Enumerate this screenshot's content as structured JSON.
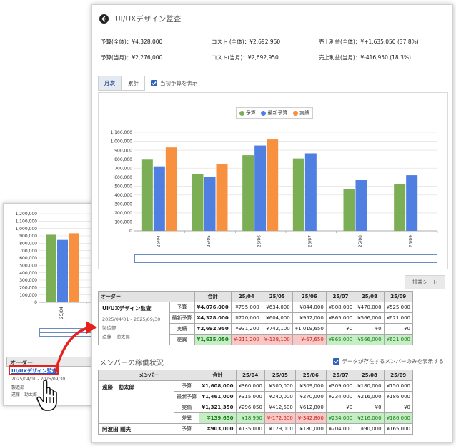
{
  "header": {
    "title": "UI/UXデザイン監査"
  },
  "summary": {
    "budget_total": "予算(全体)：¥4,328,000",
    "budget_current": "予算(当月)：¥2,276,000",
    "cost_total": "コスト (全体)：¥2,692,950",
    "cost_current": "コスト(当月)：¥2,692,950",
    "profit_total": "売上利益(全体)：¥+1,635,050 (37.8%)",
    "profit_current": "売上利益(当月)：¥-416,950 (18.3%)"
  },
  "tabs": {
    "monthly": "月次",
    "cumulative": "累計",
    "show_initial_budget": "当初予算を表示"
  },
  "pl_sheet_button": "損益シート",
  "colors": {
    "budget": "#7bae55",
    "latest_budget": "#4f7fe0",
    "actual": "#f7913f",
    "negative_bg": "#f9c8c6",
    "positive_bg": "#c5eec5"
  },
  "chart_data": [
    {
      "type": "bar",
      "categories": [
        "25/04",
        "25/05",
        "25/06",
        "25/07",
        "25/08",
        "25/09"
      ],
      "series": [
        {
          "name": "予算",
          "values": [
            795000,
            634000,
            844000,
            808000,
            470000,
            525000
          ]
        },
        {
          "name": "最新予算",
          "values": [
            720000,
            604000,
            952000,
            865000,
            566000,
            621000
          ]
        },
        {
          "name": "実績",
          "values": [
            931200,
            742100,
            1019650,
            0,
            0,
            0
          ]
        }
      ],
      "y_ticks": [
        "0",
        "100,000",
        "200,000",
        "300,000",
        "400,000",
        "500,000",
        "600,000",
        "700,000",
        "800,000",
        "900,000",
        "1,000,000",
        "1,100,000"
      ],
      "ylim": [
        0,
        1100000
      ],
      "legend": "top-center"
    },
    {
      "type": "bar",
      "categories": [
        "25/04"
      ],
      "series": [
        {
          "name": "予算",
          "values": [
            915000
          ]
        },
        {
          "name": "最新予算",
          "values": [
            845000
          ]
        },
        {
          "name": "実績",
          "values": [
            935000
          ]
        }
      ],
      "y_ticks": [
        "0",
        "100,000",
        "200,000",
        "300,000",
        "400,000",
        "500,000",
        "600,000",
        "700,000",
        "800,000",
        "900,000",
        "1,000,000",
        "1,100,000",
        "1,200,000"
      ],
      "ylim": [
        0,
        1200000
      ]
    }
  ],
  "order_table": {
    "headers": [
      "オーダー",
      "合計",
      "25/04",
      "25/05",
      "25/06",
      "25/07",
      "25/08",
      "25/09"
    ],
    "order_name": "UI/UXデザイン監査",
    "period": "2025/04/01 - 2025/09/30",
    "department": "製造部",
    "manager": "遠藤　勘太郎",
    "rows": [
      {
        "label": "予算",
        "cells": [
          "¥4,076,000",
          "¥795,000",
          "¥634,000",
          "¥844,000",
          "¥808,000",
          "¥470,000",
          "¥525,000"
        ]
      },
      {
        "label": "最新予算",
        "cells": [
          "¥4,328,000",
          "¥720,000",
          "¥604,000",
          "¥952,000",
          "¥865,000",
          "¥566,000",
          "¥621,000"
        ]
      },
      {
        "label": "実績",
        "cells": [
          "¥2,692,950",
          "¥931,200",
          "¥742,100",
          "¥1,019,650",
          "¥0",
          "¥0",
          "¥0"
        ]
      },
      {
        "label": "差異",
        "cells": [
          "¥1,635,050",
          "¥-211,200",
          "¥-138,100",
          "¥-67,650",
          "¥865,000",
          "¥566,000",
          "¥621,000"
        ]
      }
    ]
  },
  "members": {
    "title": "メンバーの稼働状況",
    "only_with_data": "データが存在するメンバーのみを表示する",
    "headers": [
      "メンバー",
      "合計",
      "25/04",
      "25/05",
      "25/06",
      "25/07",
      "25/08",
      "25/09"
    ],
    "member1": {
      "name": "遠藤　勘太郎",
      "rows": [
        {
          "label": "予算",
          "cells": [
            "¥1,608,000",
            "¥360,000",
            "¥300,000",
            "¥309,000",
            "¥309,000",
            "¥180,000",
            "¥150,000"
          ]
        },
        {
          "label": "最新予算",
          "cells": [
            "¥1,461,000",
            "¥315,000",
            "¥240,000",
            "¥270,000",
            "¥234,000",
            "¥216,000",
            "¥186,000"
          ]
        },
        {
          "label": "実績",
          "cells": [
            "¥1,321,350",
            "¥296,050",
            "¥412,500",
            "¥612,800",
            "¥0",
            "¥0",
            "¥0"
          ]
        },
        {
          "label": "差異",
          "cells": [
            "¥139,650",
            "¥18,950",
            "¥-172,500",
            "¥-342,800",
            "¥234,000",
            "¥216,000",
            "¥186,000"
          ]
        }
      ]
    },
    "member2": {
      "name": "阿波田 剛夫",
      "rows": [
        {
          "label": "予算",
          "cells": [
            "¥903,000",
            "¥135,000",
            "¥129,000",
            "¥180,000",
            "¥204,000",
            "¥90,000",
            "¥165,000"
          ]
        }
      ]
    }
  },
  "back_window": {
    "order_header": "オーダー",
    "order_link": "UI/UXデザイン監査",
    "period": "2025/04/01 - 2025/09/30",
    "department": "製造部",
    "manager": "遠藤　勘太郎"
  }
}
